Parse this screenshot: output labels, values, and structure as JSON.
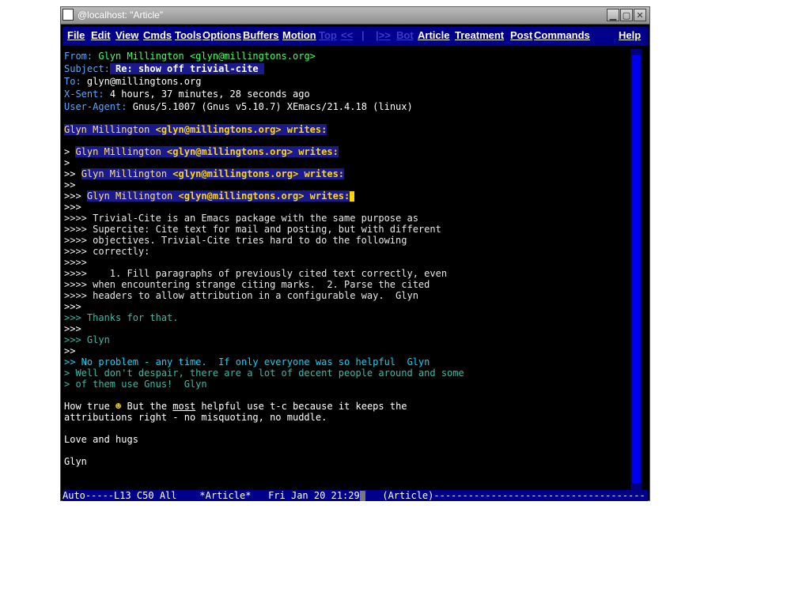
{
  "window": {
    "title": "@localhost: \"Article\"",
    "minimize": "▁",
    "maximize": "▢",
    "close": "✕"
  },
  "menu": {
    "items": [
      "File",
      "Edit",
      "View",
      "Cmds",
      "Tools",
      "Options",
      "Buffers",
      "Motion",
      "Top",
      "<<",
      "|",
      "|>>",
      "Bot",
      "Article",
      "Treatment",
      "Post",
      "Commands",
      "Help"
    ]
  },
  "headers": {
    "from_key": "From:",
    "from_val": "Glyn Millington <glyn@millingtons.org>",
    "subject_key": "Subject:",
    "subject_val": "Re: show off trivial-cite",
    "to_key": "To:",
    "to_val": "glyn@millingtons.org",
    "xsent_key": "X-Sent:",
    "xsent_val": "4 hours, 37 minutes, 28 seconds ago",
    "ua_key": "User-Agent:",
    "ua_val": "Gnus/5.1007 (Gnus v5.10.7) XEmacs/21.4.18 (linux)"
  },
  "body": {
    "attr1_name": "Glyn Millington ",
    "attr1_addr": "<glyn@millingtons.org>",
    "attr1_writes": " writes:",
    "attr2_prefix": "> ",
    "attr2_name": "Glyn Millington ",
    "attr2_addr": "<glyn@millingtons.org>",
    "attr2_writes": " writes:",
    "q1_blank": ">",
    "attr3_prefix": ">> ",
    "attr3_name": "Glyn Millington ",
    "attr3_addr": "<glyn@millingtons.org>",
    "attr3_writes": " writes:",
    "q2_blank": ">>",
    "attr4_prefix": ">>> ",
    "attr4_name": "Glyn Millington ",
    "attr4_addr": "<glyn@millingtons.org>",
    "attr4_writes": " writes:",
    "q3_blank": ">>>",
    "q4_lines": [
      ">>>> Trivial-Cite is an Emacs package with the same purpose as",
      ">>>> Supercite: Cite text for mail and posting, but with different",
      ">>>> objectives. Trivial-Cite tries hard to do the following",
      ">>>> correctly:",
      ">>>>",
      ">>>>    1. Fill paragraphs of previously cited text correctly, even",
      ">>>> when encountering strange citing marks.  2. Parse the cited",
      ">>>> headers to allow attribution in a configurable way.  Glyn"
    ],
    "q3_b1": ">>>",
    "q3_thanks": ">>> Thanks for that.",
    "q3_b2": ">>>",
    "q3_glyn": ">>> Glyn",
    "q2_b": ">>",
    "q2_text": ">> No problem - any time.  If only everyone was so helpful  Glyn",
    "q1_text1": "> Well don't despair, there are a lot of decent people around and some",
    "q1_text2": "> of them use Gnus!  Glyn",
    "p1_a": "How true ",
    "smiley": "☻",
    "p1_b": " But the ",
    "p1_most": "most",
    "p1_c": " helpful use t-c because it keeps the",
    "p1_line2": "attributions right - no misquoting, no muddle.",
    "love": "Love and hugs",
    "sig": "Glyn"
  },
  "modeline": {
    "left": "Auto-----L13 C50 All    *Article*   Fri Jan 20 21:29",
    "right": "   (Article)-------------------------------------"
  }
}
